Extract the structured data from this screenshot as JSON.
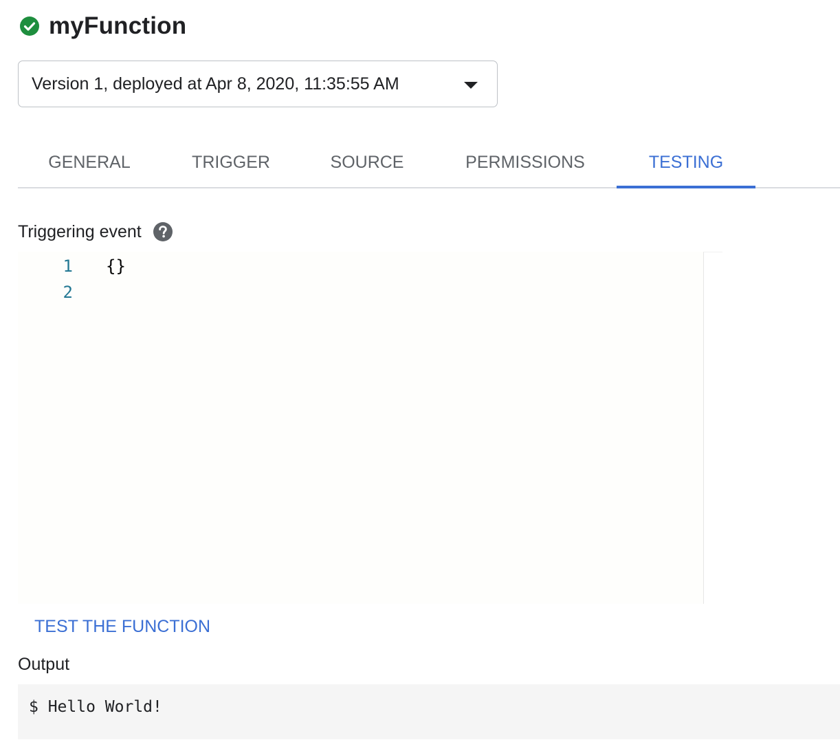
{
  "header": {
    "status_icon": "check-circle-icon",
    "status_color": "#1e8e3e",
    "title": "myFunction"
  },
  "version_select": {
    "selected": "Version 1, deployed at Apr 8, 2020, 11:35:55 AM",
    "caret_icon": "arrow-drop-down-icon"
  },
  "tabs": [
    {
      "label": "GENERAL",
      "active": false
    },
    {
      "label": "TRIGGER",
      "active": false
    },
    {
      "label": "SOURCE",
      "active": false
    },
    {
      "label": "PERMISSIONS",
      "active": false
    },
    {
      "label": "TESTING",
      "active": true
    }
  ],
  "accent_color": "#3b6fd4",
  "triggering_event": {
    "label": "Triggering event",
    "help_icon": "help-circle-icon",
    "lines": [
      {
        "number": "1",
        "code": "{}"
      },
      {
        "number": "2",
        "code": ""
      }
    ]
  },
  "test_button": {
    "label": "TEST THE FUNCTION"
  },
  "output": {
    "label": "Output",
    "text": "$ Hello World!"
  }
}
